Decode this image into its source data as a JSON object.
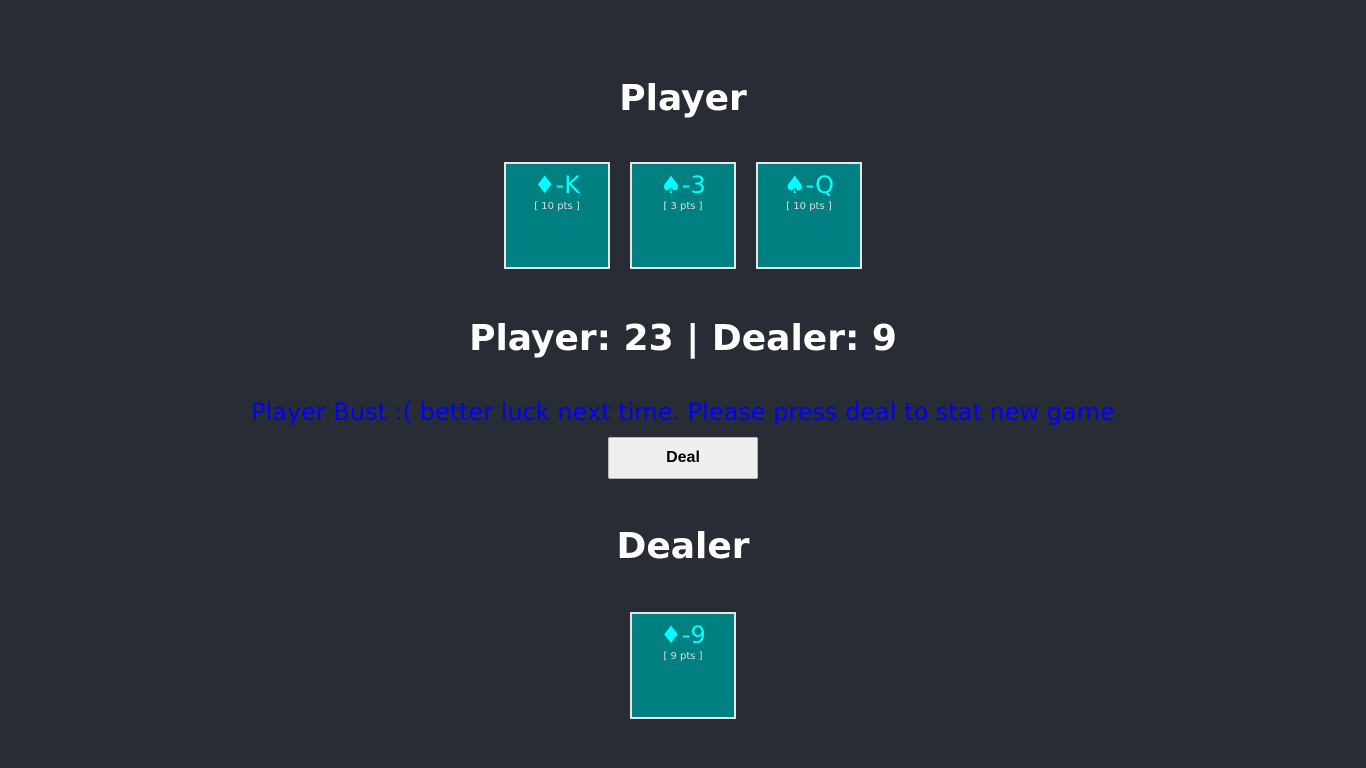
{
  "player": {
    "heading": "Player",
    "cards": [
      {
        "label": "♦-K",
        "points": "[ 10 pts ]"
      },
      {
        "label": "♠-3",
        "points": "[ 3 pts ]"
      },
      {
        "label": "♠-Q",
        "points": "[ 10 pts ]"
      }
    ]
  },
  "score_line": "Player: 23 | Dealer: 9",
  "status_message": "Player Bust :( better luck next time. Please press deal to stat new game",
  "deal_button_label": "Deal",
  "dealer": {
    "heading": "Dealer",
    "cards": [
      {
        "label": "♦-9",
        "points": "[ 9 pts ]"
      }
    ]
  },
  "colors": {
    "background": "#282c34",
    "card_fill": "#008080",
    "card_label": "#00ffff",
    "status_message": "#0000ff"
  }
}
